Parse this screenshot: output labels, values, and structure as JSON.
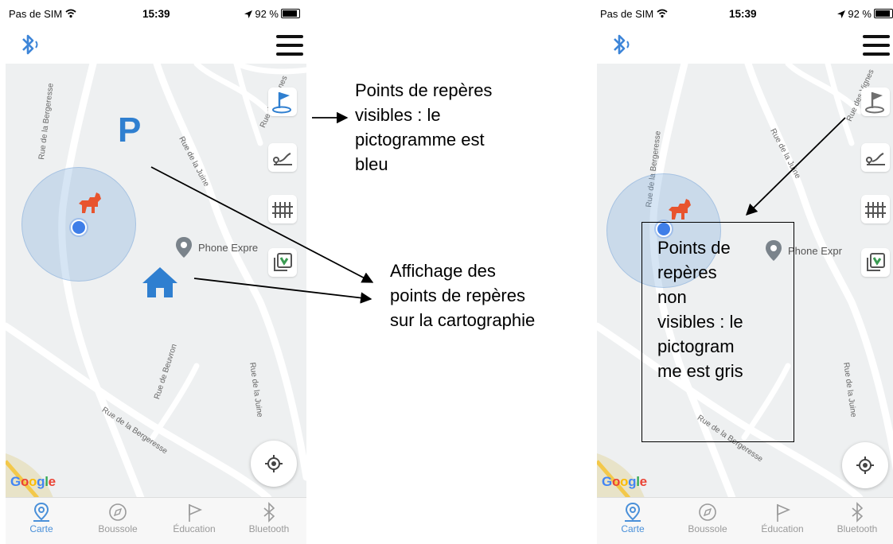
{
  "status": {
    "carrier": "Pas de SIM",
    "time": "15:39",
    "battery": "92 %"
  },
  "map": {
    "google": "Google",
    "poi": "Phone Expre",
    "poi_right": "Phone Expr",
    "roads": {
      "bergeresse_vertical": "Rue de la Bergeresse",
      "juine_top": "Rue de la Juine",
      "juine_bottom": "Rue de la Juine",
      "beuvron": "Rue de Beuvron",
      "bergeresse_bottom": "Rue de la Bergeresse",
      "top_right": "Rue des Vignes"
    },
    "parking_letter": "P"
  },
  "tabs": [
    {
      "label": "Carte",
      "icon": "map-pin-icon",
      "active": true
    },
    {
      "label": "Boussole",
      "icon": "compass-icon",
      "active": false
    },
    {
      "label": "Éducation",
      "icon": "flag-icon",
      "active": false
    },
    {
      "label": "Bluetooth",
      "icon": "bluetooth-icon",
      "active": false
    }
  ],
  "annotations": {
    "visible": "Points de repères visibles : le pictogramme est bleu",
    "visible_lines": [
      "Points de repères",
      "visibles : le",
      "pictogramme est",
      "bleu"
    ],
    "display_lines": [
      "Affichage des",
      "points de repères",
      "sur la cartographie"
    ],
    "hidden_lines": [
      "Points de",
      "repères",
      "non",
      "visibles : le",
      "pictogram",
      "me est gris"
    ]
  },
  "colors": {
    "accent": "#4a90d9",
    "landmark_blue": "#2f7fd0",
    "landmark_grey": "#6f6f6f",
    "dog": "#e8542e"
  }
}
